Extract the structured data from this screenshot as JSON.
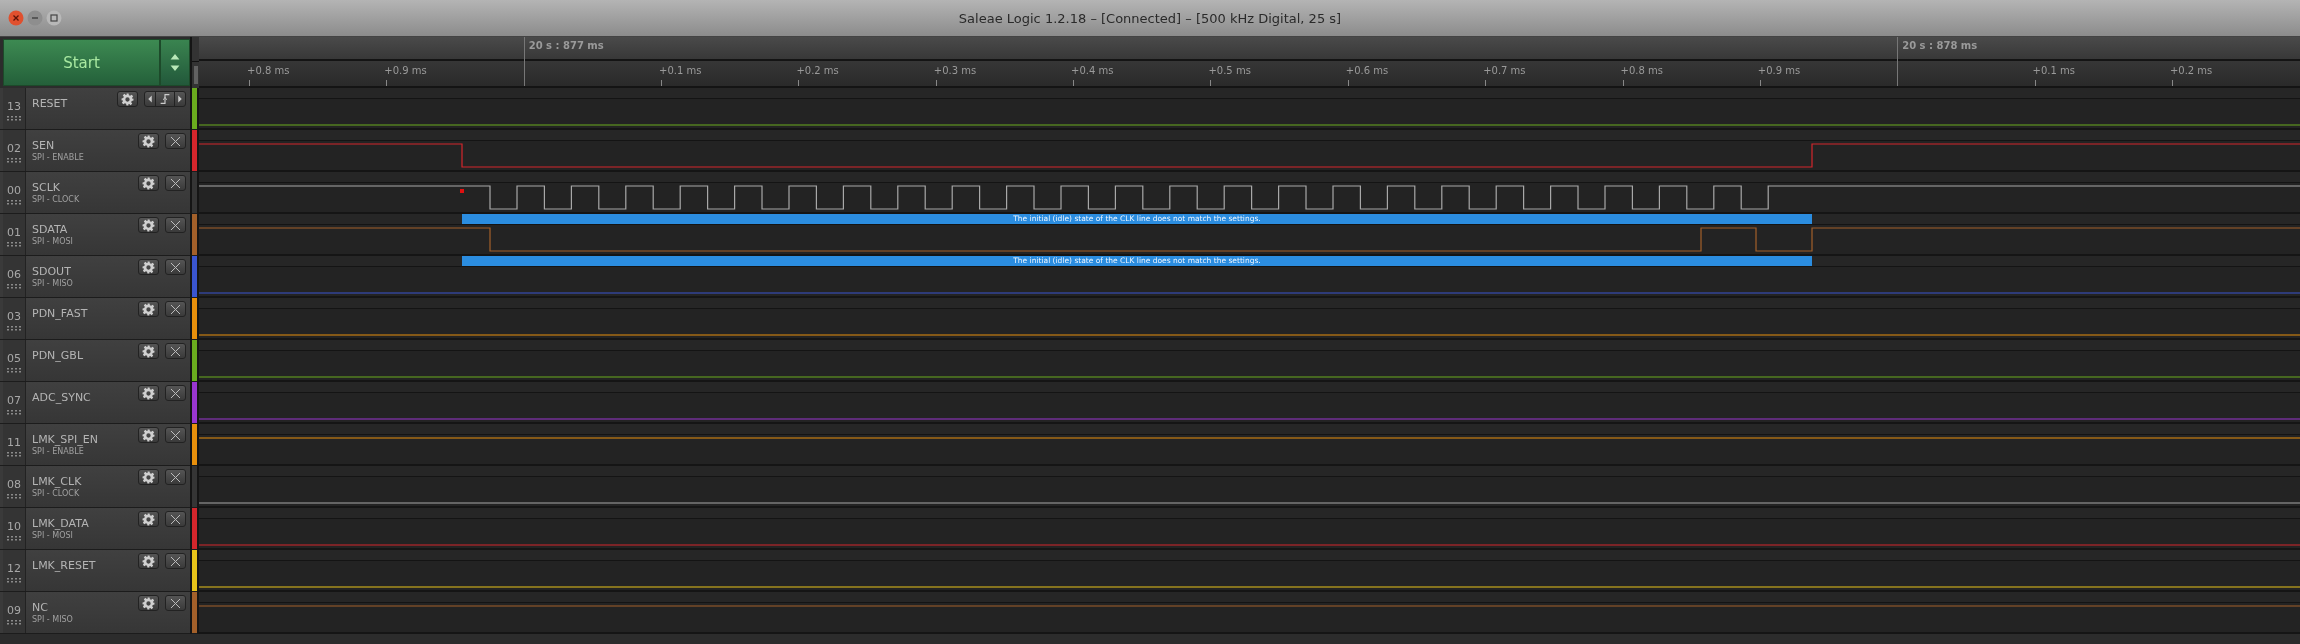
{
  "window": {
    "title": "Saleae Logic 1.2.18 – [Connected] – [500 kHz Digital, 25 s]"
  },
  "start_button": {
    "label": "Start"
  },
  "timeline": {
    "ticks": [
      {
        "kind": "minor",
        "label": "+0.8 ms"
      },
      {
        "kind": "minor",
        "label": "+0.9 ms"
      },
      {
        "kind": "major",
        "label": "20 s : 877 ms"
      },
      {
        "kind": "minor",
        "label": "+0.1 ms"
      },
      {
        "kind": "minor",
        "label": "+0.2 ms"
      },
      {
        "kind": "minor",
        "label": "+0.3 ms"
      },
      {
        "kind": "minor",
        "label": "+0.4 ms"
      },
      {
        "kind": "minor",
        "label": "+0.5 ms"
      },
      {
        "kind": "minor",
        "label": "+0.6 ms"
      },
      {
        "kind": "minor",
        "label": "+0.7 ms"
      },
      {
        "kind": "minor",
        "label": "+0.8 ms"
      },
      {
        "kind": "minor",
        "label": "+0.9 ms"
      },
      {
        "kind": "major",
        "label": "20 s : 878 ms"
      },
      {
        "kind": "minor",
        "label": "+0.1 ms"
      },
      {
        "kind": "minor",
        "label": "+0.2 ms"
      }
    ]
  },
  "channels": [
    {
      "number": "13",
      "name": "RESET",
      "color": "#6aac1e",
      "kind": "low",
      "trigger": true
    },
    {
      "number": "02",
      "name": "SEN",
      "protocol": "SPI - ENABLE",
      "color": "#d4262c",
      "kind": "enable",
      "trigger": false
    },
    {
      "number": "00",
      "name": "SCLK",
      "protocol": "SPI - CLOCK",
      "color": "#353535",
      "kind": "clock",
      "trigger": false,
      "error_dot": true
    },
    {
      "number": "01",
      "name": "SDATA",
      "protocol": "SPI - MOSI",
      "color": "#a3602a",
      "kind": "data",
      "trigger": false,
      "annotation": "The initial (idle) state of the CLK line does not match the settings."
    },
    {
      "number": "06",
      "name": "SDOUT",
      "protocol": "SPI - MISO",
      "color": "#3a55d0",
      "kind": "low",
      "trigger": false,
      "annotation": "The initial (idle) state of the CLK line does not match the settings."
    },
    {
      "number": "03",
      "name": "PDN_FAST",
      "color": "#e8900c",
      "kind": "low",
      "trigger": false
    },
    {
      "number": "05",
      "name": "PDN_GBL",
      "color": "#6aac1e",
      "kind": "low",
      "trigger": false
    },
    {
      "number": "07",
      "name": "ADC_SYNC",
      "color": "#9a36d0",
      "kind": "low",
      "trigger": false
    },
    {
      "number": "11",
      "name": "LMK_SPI_EN",
      "protocol": "SPI - ENABLE",
      "color": "#e8900c",
      "kind": "high",
      "trigger": false
    },
    {
      "number": "08",
      "name": "LMK_CLK",
      "protocol": "SPI - CLOCK",
      "color": "#353535",
      "kind": "low",
      "trigger": false
    },
    {
      "number": "10",
      "name": "LMK_DATA",
      "protocol": "SPI - MOSI",
      "color": "#d4262c",
      "kind": "low",
      "trigger": false
    },
    {
      "number": "12",
      "name": "LMK_RESET",
      "color": "#e8c41a",
      "kind": "low",
      "trigger": false
    },
    {
      "number": "09",
      "name": "NC",
      "protocol": "SPI - MISO",
      "color": "#a3602a",
      "kind": "high",
      "trigger": false
    }
  ]
}
